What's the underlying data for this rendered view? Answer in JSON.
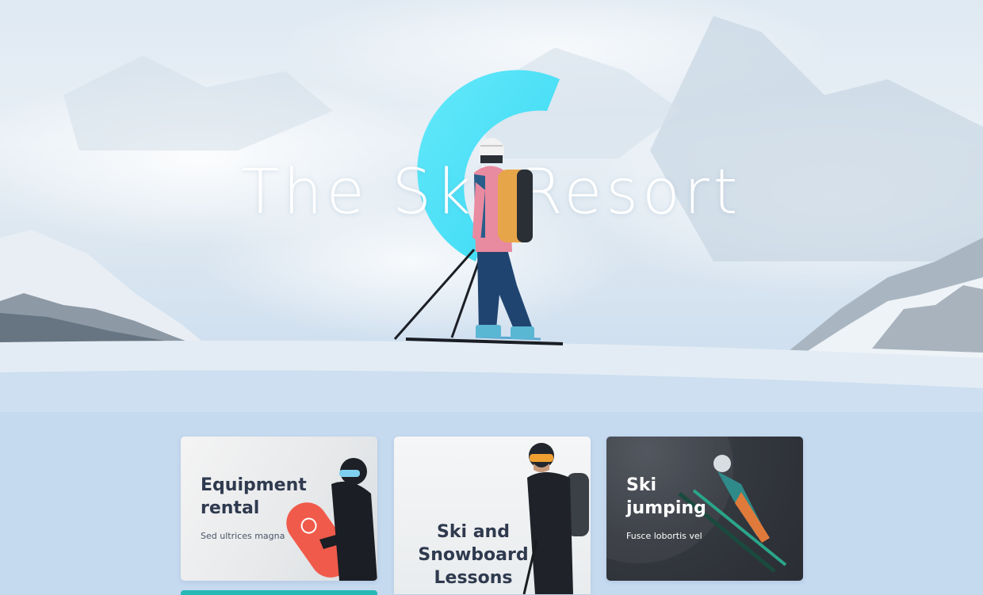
{
  "hero": {
    "title": "The Ski   Resort",
    "accent_color": "#4ee8f8"
  },
  "cards": [
    {
      "title": "Equipment rental",
      "subtitle": "Sed ultrices magna"
    },
    {
      "title": "Ski and Snowboard Lessons",
      "subtitle": ""
    },
    {
      "title": "Ski jumping",
      "subtitle": "Fusce lobortis vel"
    }
  ],
  "colors": {
    "page_background": "#c5d9ef",
    "title_text": "#2f3a4f",
    "teal": "#26b8b5"
  }
}
